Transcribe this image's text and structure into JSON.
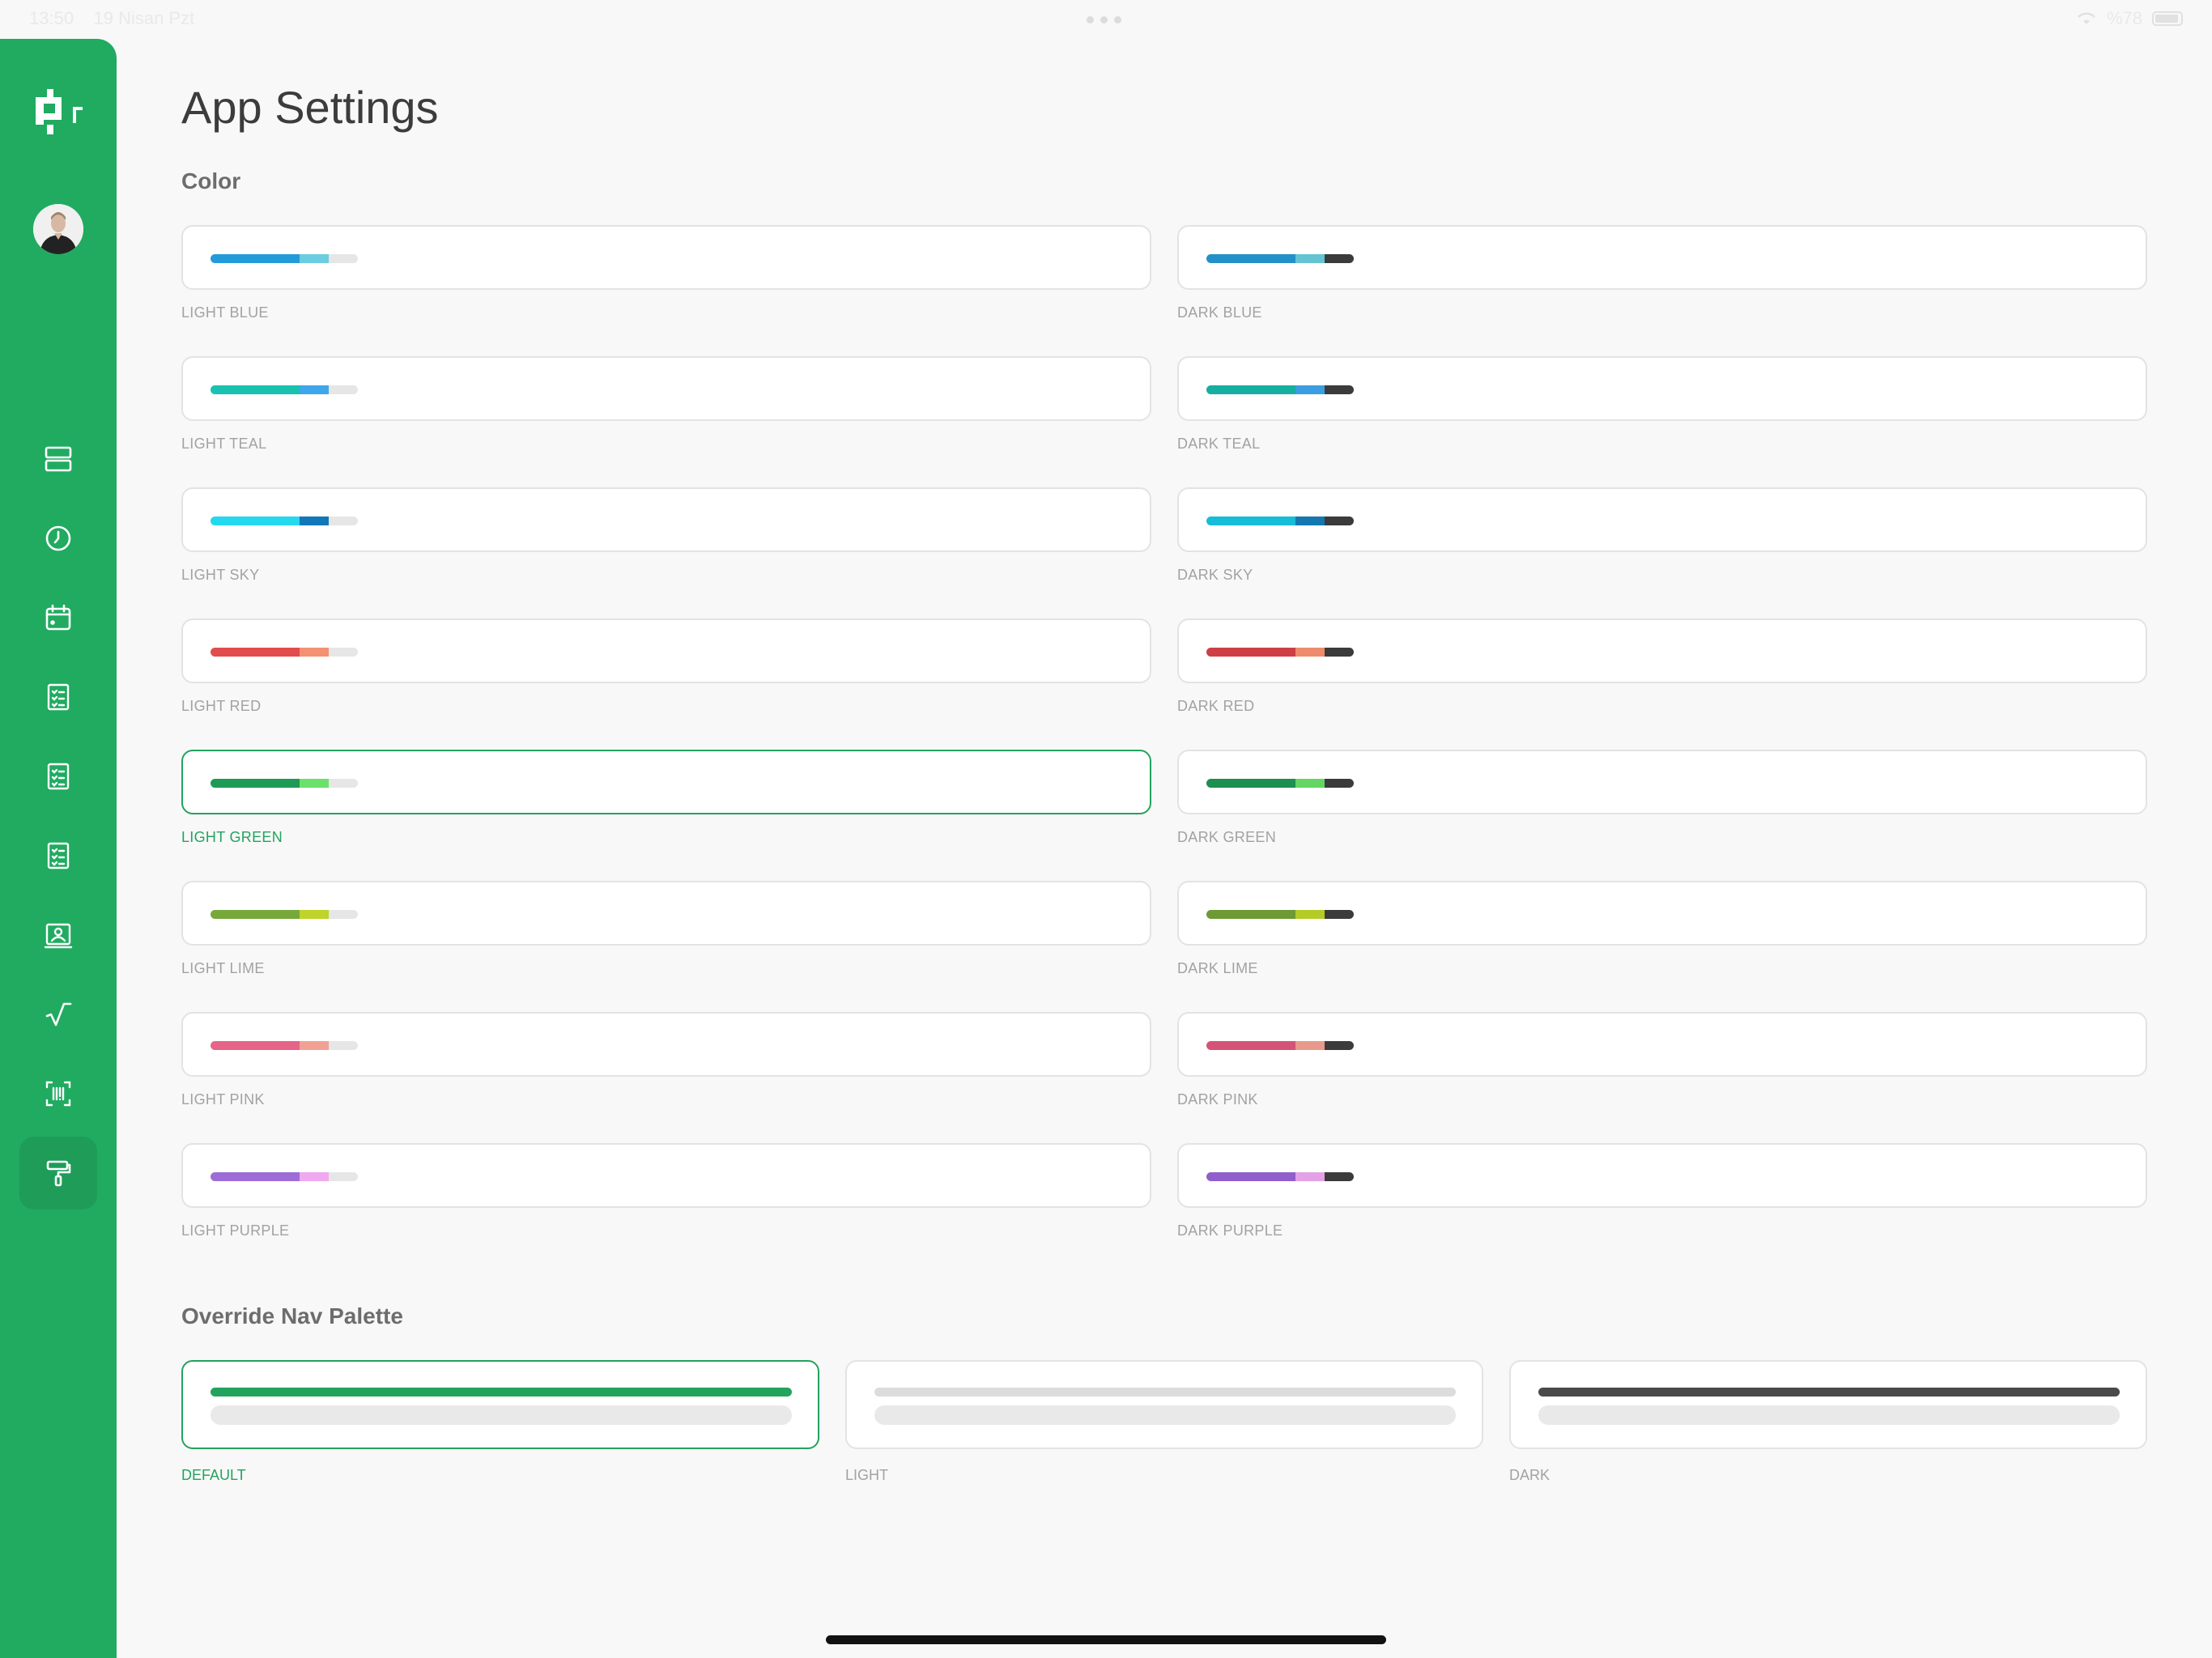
{
  "status": {
    "time": "13:50",
    "date": "19 Nisan Pzt",
    "battery": "%78"
  },
  "page": {
    "title": "App Settings"
  },
  "color_section": {
    "title": "Color",
    "swatches": [
      {
        "label": "LIGHT BLUE",
        "colors": [
          "#239bd9",
          "#6ccde0",
          "#e6e6e6"
        ],
        "selected": false
      },
      {
        "label": "DARK BLUE",
        "colors": [
          "#2391c7",
          "#65c4d4",
          "#3b3b3b"
        ],
        "selected": false
      },
      {
        "label": "LIGHT TEAL",
        "colors": [
          "#18c1b0",
          "#3ea6ea",
          "#e6e6e6"
        ],
        "selected": false
      },
      {
        "label": "DARK TEAL",
        "colors": [
          "#15aea0",
          "#3a9ee0",
          "#3b3b3b"
        ],
        "selected": false
      },
      {
        "label": "LIGHT SKY",
        "colors": [
          "#24d8f0",
          "#1177b8",
          "#e6e6e6"
        ],
        "selected": false
      },
      {
        "label": "DARK SKY",
        "colors": [
          "#17bcd8",
          "#1378b0",
          "#3b3b3b"
        ],
        "selected": false
      },
      {
        "label": "LIGHT RED",
        "colors": [
          "#e24c4c",
          "#f39172",
          "#e6e6e6"
        ],
        "selected": false
      },
      {
        "label": "DARK RED",
        "colors": [
          "#cd3f45",
          "#ee8b6c",
          "#3b3b3b"
        ],
        "selected": false
      },
      {
        "label": "LIGHT GREEN",
        "colors": [
          "#1f9a56",
          "#6be06b",
          "#e6e6e6"
        ],
        "selected": true
      },
      {
        "label": "DARK GREEN",
        "colors": [
          "#1d8f50",
          "#63d663",
          "#3b3b3b"
        ],
        "selected": false
      },
      {
        "label": "LIGHT LIME",
        "colors": [
          "#77a83a",
          "#bed42a",
          "#e6e6e6"
        ],
        "selected": false
      },
      {
        "label": "DARK LIME",
        "colors": [
          "#6d9a34",
          "#b5cc27",
          "#3b3b3b"
        ],
        "selected": false
      },
      {
        "label": "LIGHT PINK",
        "colors": [
          "#e56488",
          "#f1a193",
          "#e6e6e6"
        ],
        "selected": false
      },
      {
        "label": "DARK PINK",
        "colors": [
          "#d45478",
          "#e8998b",
          "#3b3b3b"
        ],
        "selected": false
      },
      {
        "label": "LIGHT PURPLE",
        "colors": [
          "#9d6cd6",
          "#efa9ef",
          "#e6e6e6"
        ],
        "selected": false
      },
      {
        "label": "DARK PURPLE",
        "colors": [
          "#915fcc",
          "#e4a1e6",
          "#3b3b3b"
        ],
        "selected": false
      }
    ]
  },
  "nav_palette": {
    "title": "Override Nav Palette",
    "options": [
      {
        "label": "DEFAULT",
        "color": "#23a35e",
        "selected": true
      },
      {
        "label": "LIGHT",
        "color": "#dcdcdc",
        "selected": false
      },
      {
        "label": "DARK",
        "color": "#4a4a4a",
        "selected": false
      }
    ]
  },
  "sidebar": {
    "accent": "#20ab60",
    "items": [
      {
        "icon": "server-icon"
      },
      {
        "icon": "clock-icon"
      },
      {
        "icon": "calendar-icon"
      },
      {
        "icon": "checklist-icon"
      },
      {
        "icon": "checklist-icon"
      },
      {
        "icon": "checklist-icon"
      },
      {
        "icon": "id-card-icon"
      },
      {
        "icon": "square-root-icon"
      },
      {
        "icon": "barcode-scan-icon"
      },
      {
        "icon": "paint-roller-icon",
        "active": true
      }
    ]
  }
}
